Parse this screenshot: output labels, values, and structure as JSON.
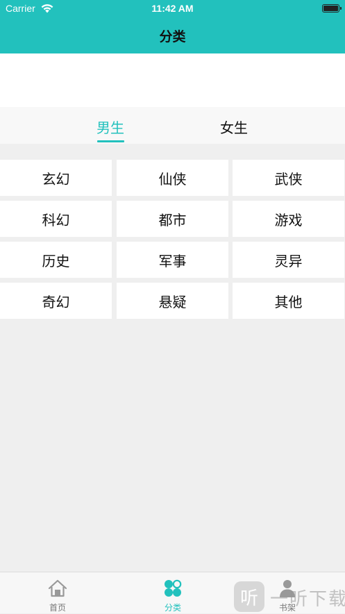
{
  "status_bar": {
    "carrier": "Carrier",
    "time": "11:42 AM"
  },
  "nav": {
    "title": "分类"
  },
  "tabs": {
    "male": "男生",
    "female": "女生",
    "selected": "男生"
  },
  "categories": [
    [
      "玄幻",
      "仙侠",
      "武侠"
    ],
    [
      "科幻",
      "都市",
      "游戏"
    ],
    [
      "历史",
      "军事",
      "灵异"
    ],
    [
      "奇幻",
      "悬疑",
      "其他"
    ]
  ],
  "tabbar": {
    "items": [
      {
        "label": "首页",
        "icon": "home-icon"
      },
      {
        "label": "分类",
        "icon": "category-icon"
      },
      {
        "label": "书架",
        "icon": "bookshelf-icon"
      }
    ],
    "active": "分类"
  },
  "watermark": {
    "badge": "听",
    "text": "一听下载"
  },
  "colors": {
    "accent": "#22c1bd",
    "background": "#efefef"
  }
}
